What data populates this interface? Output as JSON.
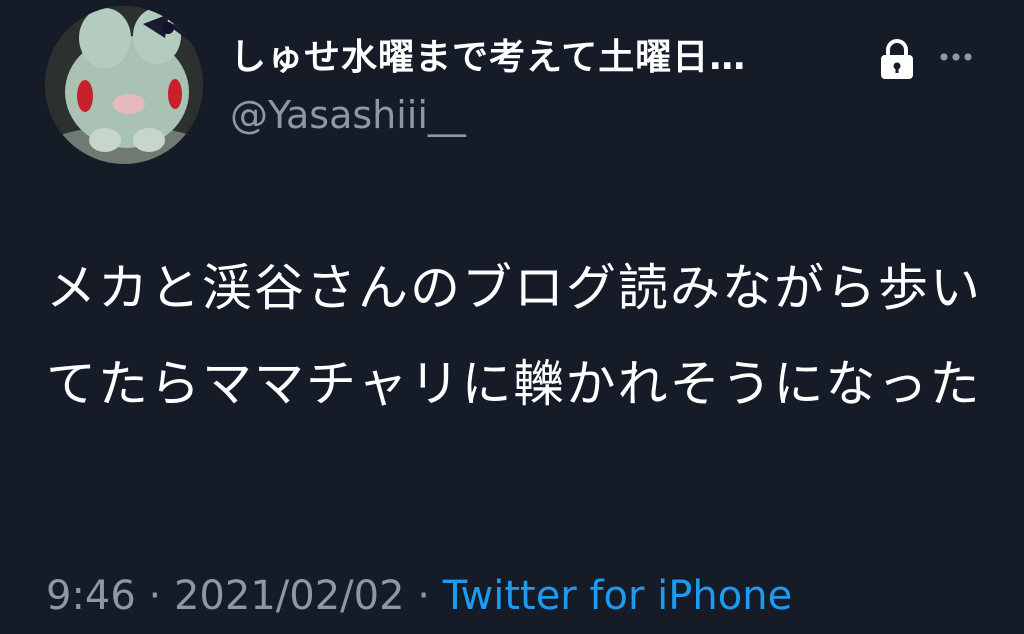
{
  "author": {
    "display_name": "しゅせ水曜まで考えて土曜日…",
    "handle": "@Yasashiii__",
    "avatar_icon": "plush-bunny-avatar"
  },
  "icons": {
    "lock": "lock-icon",
    "more": "more-icon"
  },
  "tweet": {
    "text": "メカと渓谷さんのブログ読みながら歩いてたらママチャリに轢かれそうになった",
    "time": "9:46",
    "separator": " · ",
    "date": "2021/02/02",
    "separator2": " · ",
    "source": "Twitter for iPhone"
  },
  "colors": {
    "background": "#151b27",
    "text": "#ffffff",
    "secondary": "#8b98a5",
    "link": "#1d9bf0"
  }
}
